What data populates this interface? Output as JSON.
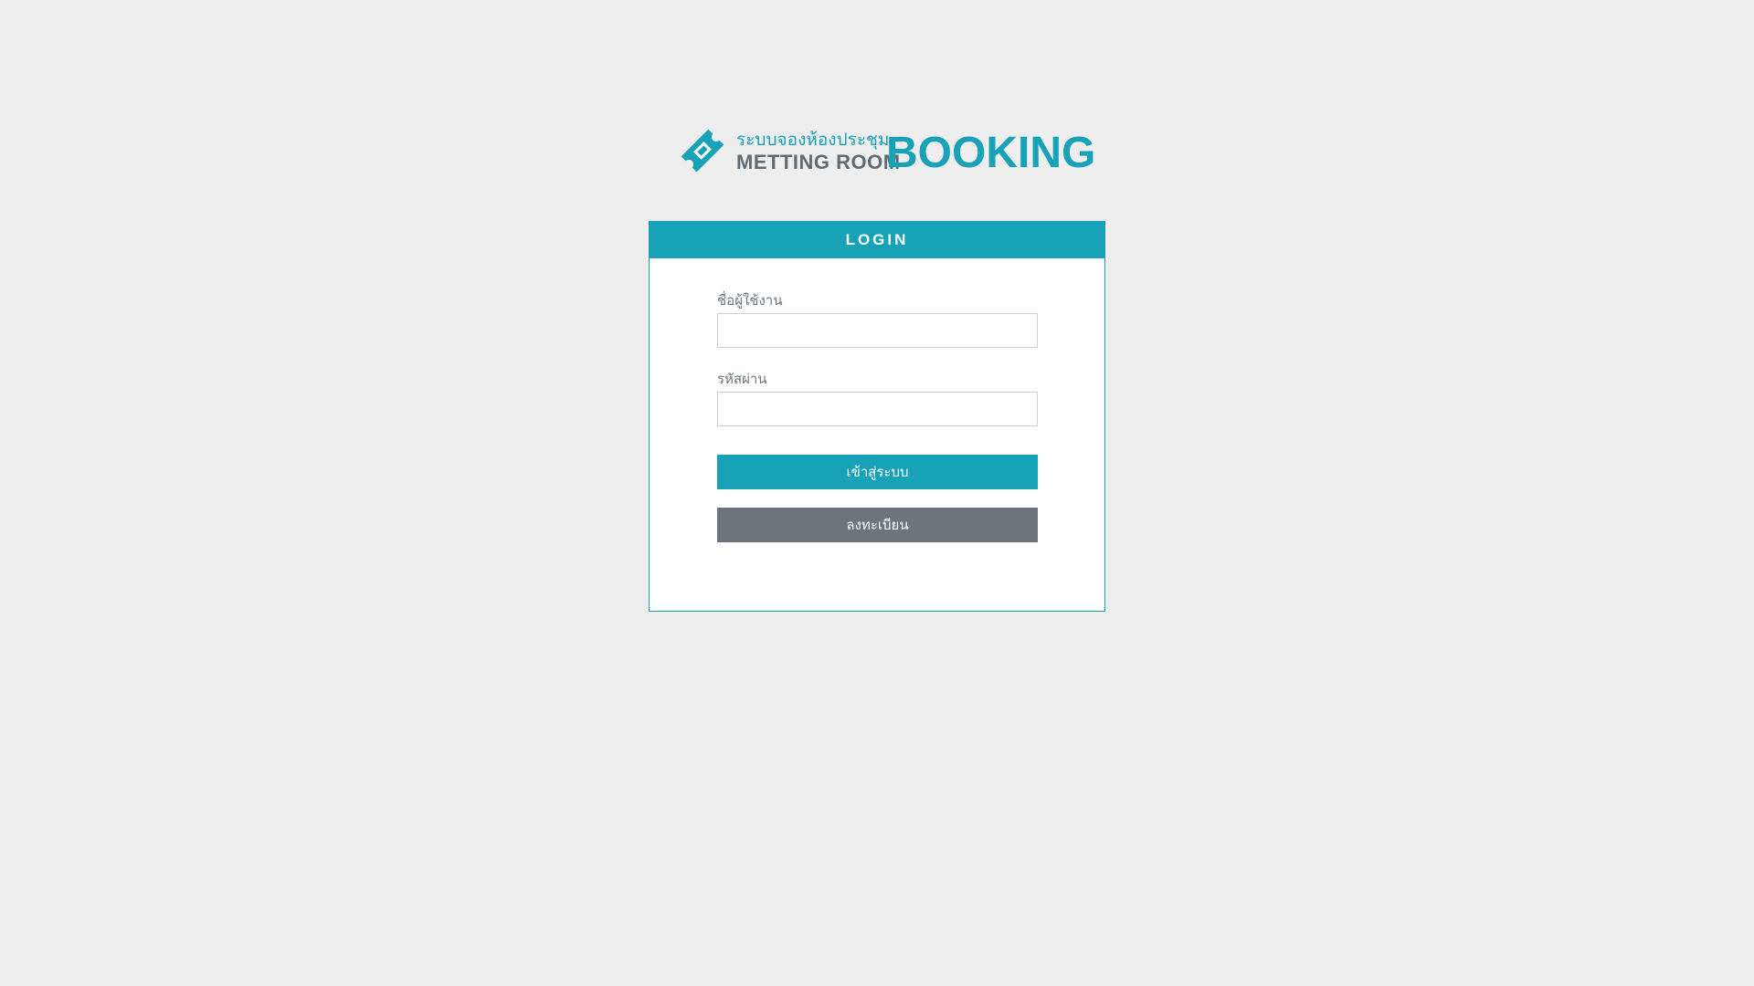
{
  "logo": {
    "thai_text": "ระบบจองห้องประชุม",
    "sub_text": "METTING ROOM",
    "main_text": "BOOKING",
    "icon": "ticket-icon"
  },
  "login_card": {
    "title": "LOGIN",
    "username_label": "ชื่อผู้ใช้งาน",
    "username_value": "",
    "password_label": "รหัสผ่าน",
    "password_value": "",
    "login_button": "เข้าสู่ระบบ",
    "register_button": "ลงทะเบียน"
  },
  "colors": {
    "accent": "#17a2b8",
    "secondary": "#6c757d",
    "background": "#eeeeee"
  }
}
